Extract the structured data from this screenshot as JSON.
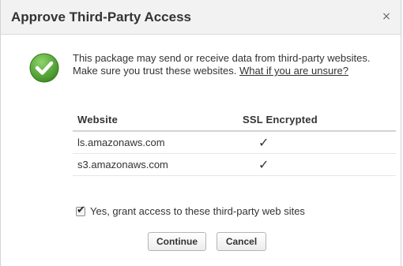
{
  "dialog": {
    "title": "Approve Third-Party Access",
    "close_glyph": "×",
    "message_prefix": "This package may send or receive data from third-party websites. Make sure you trust these websites. ",
    "message_link": "What if you are unsure?",
    "icon": "success-check-icon",
    "table": {
      "headers": [
        "Website",
        "SSL Encrypted"
      ],
      "rows": [
        {
          "website": "ls.amazonaws.com",
          "ssl": "✓"
        },
        {
          "website": "s3.amazonaws.com",
          "ssl": "✓"
        }
      ]
    },
    "grant_checkbox": {
      "checked": true,
      "label": "Yes, grant access to these third-party web sites"
    },
    "buttons": {
      "continue": "Continue",
      "cancel": "Cancel"
    },
    "colors": {
      "title_bar": "#f2f2f2",
      "check_icon": "#5aa83a",
      "border": "#cfd4d9"
    }
  }
}
